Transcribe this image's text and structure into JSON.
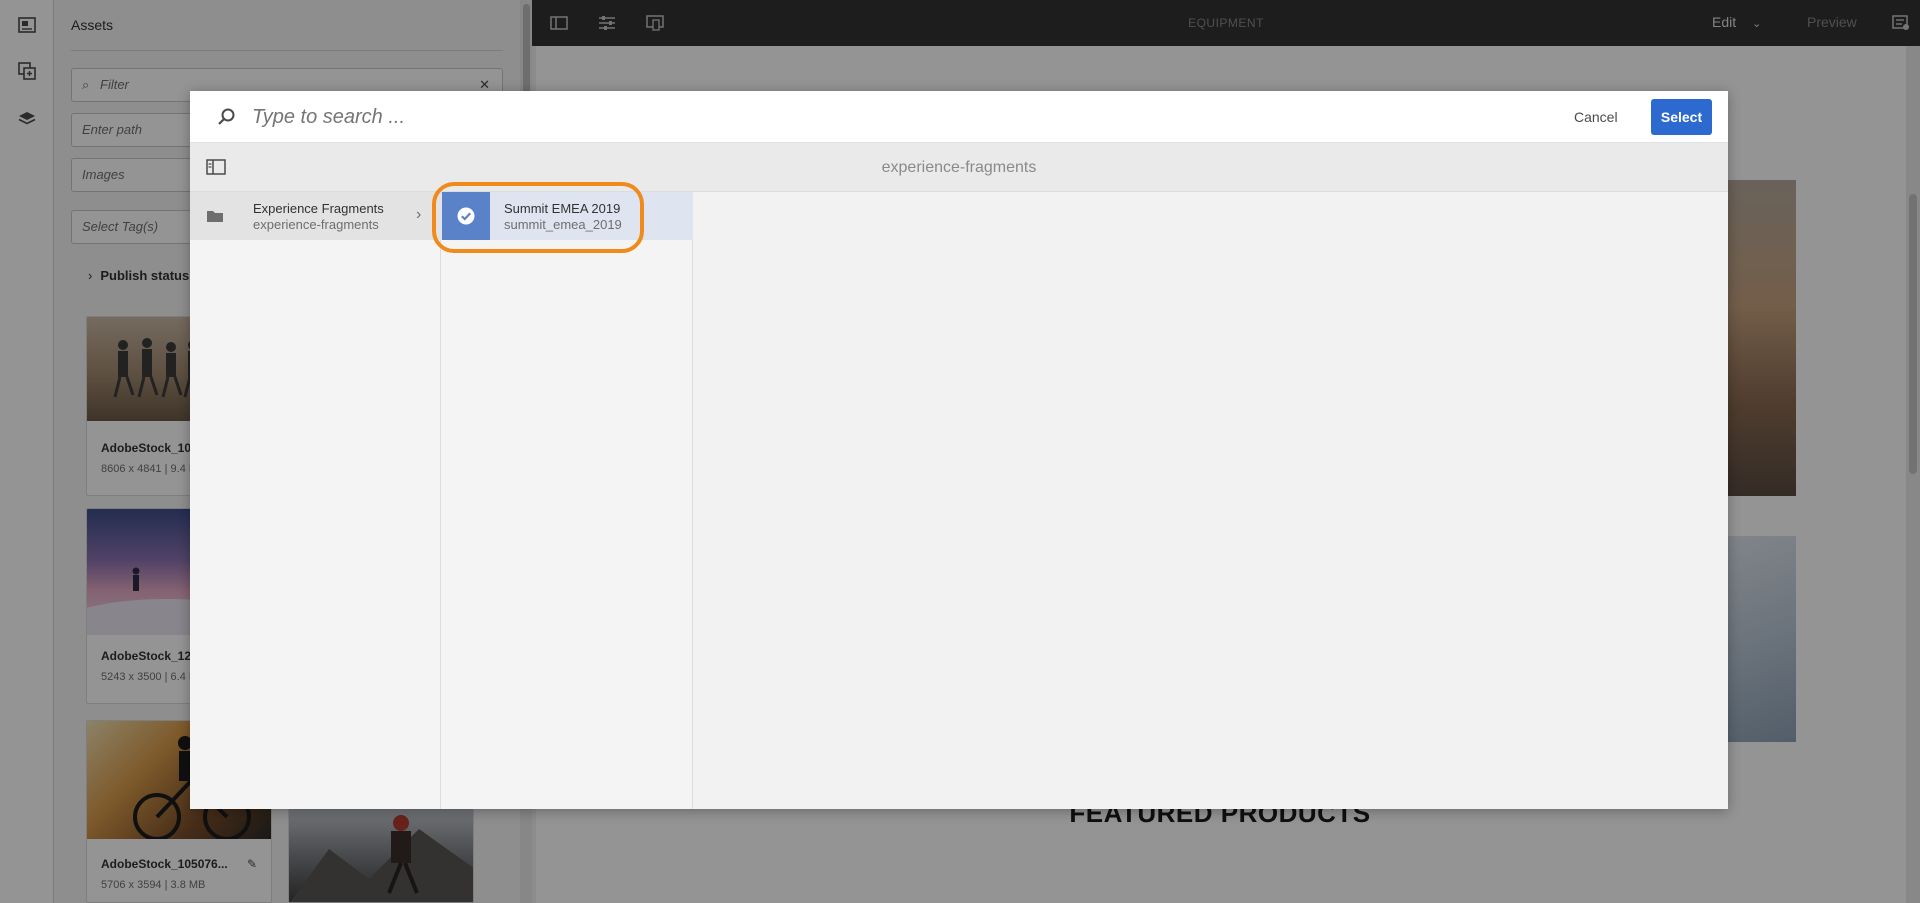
{
  "assets_panel": {
    "title": "Assets",
    "filter_placeholder": "Filter",
    "path_placeholder": "Enter path",
    "type_value": "Images",
    "tags_placeholder": "Select Tag(s)",
    "publish_status_label": "Publish status",
    "cards": [
      {
        "name": "AdobeStock_100",
        "meta": "8606 x 4841 | 9.4 M"
      },
      {
        "name": "AdobeStock_127",
        "meta": "5243 x 3500 | 6.4 M"
      },
      {
        "name": "AdobeStock_105076...",
        "meta": "5706 x 3594 | 3.8 MB"
      }
    ]
  },
  "editor": {
    "page_title": "EQUIPMENT",
    "mode_label": "Edit",
    "preview_label": "Preview",
    "featured_heading": "FEATURED PRODUCTS"
  },
  "dialog": {
    "search_placeholder": "Type to search ...",
    "cancel_label": "Cancel",
    "select_label": "Select",
    "current_path": "experience-fragments",
    "column1": {
      "title": "Experience Fragments",
      "subtitle": "experience-fragments"
    },
    "column2": {
      "title": "Summit EMEA 2019",
      "subtitle": "summit_emea_2019"
    }
  },
  "colors": {
    "accent_blue": "#2d6acf",
    "selected_tile": "#5a82c8",
    "highlight_orange": "#f08a1c"
  }
}
